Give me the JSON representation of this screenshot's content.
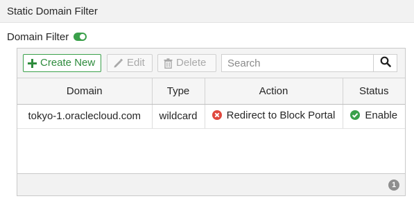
{
  "section": {
    "title": "Static Domain Filter"
  },
  "domain_filter": {
    "label": "Domain Filter",
    "enabled": true
  },
  "toolbar": {
    "create_label": "Create New",
    "edit_label": "Edit",
    "delete_label": "Delete",
    "search_placeholder": "Search"
  },
  "table": {
    "columns": [
      "Domain",
      "Type",
      "Action",
      "Status"
    ],
    "rows": [
      {
        "domain": "tokyo-1.oraclecloud.com",
        "type": "wildcard",
        "action": "Redirect to Block Portal",
        "action_icon": "block-x-icon",
        "status": "Enable",
        "status_icon": "check-circle-icon"
      }
    ]
  },
  "footer": {
    "count": "1"
  },
  "colors": {
    "accent_green": "#3aa04a",
    "action_red": "#e0483e",
    "status_green": "#3aa04a",
    "badge_gray": "#8e8e8e"
  }
}
